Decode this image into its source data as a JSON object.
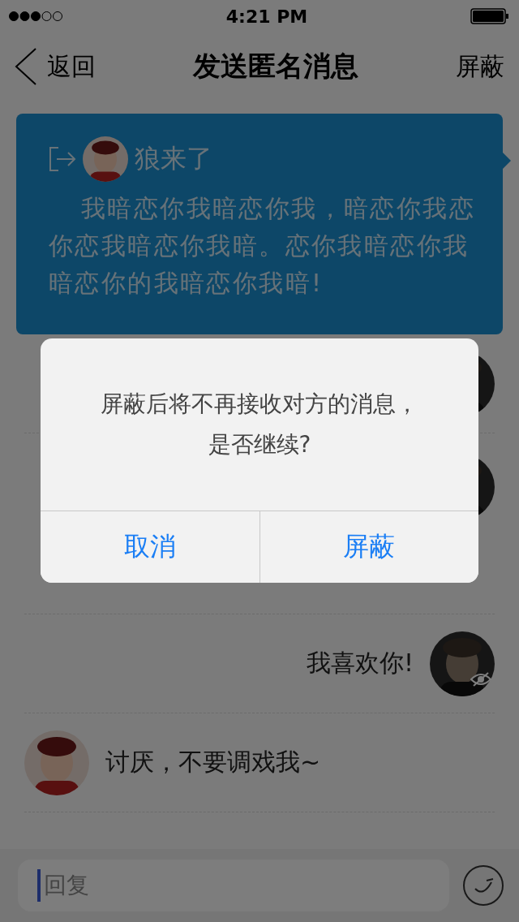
{
  "status_bar": {
    "time": "4:21 PM"
  },
  "nav": {
    "back": "返回",
    "title": "发送匿名消息",
    "action": "屏蔽"
  },
  "card": {
    "author": "狼来了",
    "text": "我暗恋你我暗恋你我，暗恋你我恋你恋我暗恋你我暗。恋你我暗恋你我暗恋你的我暗恋你我暗!"
  },
  "messages": [
    {
      "kind": "outgoing",
      "masked": false,
      "tall": false
    },
    {
      "kind": "outgoing",
      "masked": false,
      "tall": true
    },
    {
      "kind": "outgoing",
      "masked": true,
      "tall": false,
      "text": "我喜欢你!"
    },
    {
      "kind": "incoming",
      "tall": false,
      "text": "讨厌，不要调戏我~"
    }
  ],
  "reply": {
    "placeholder": "回复"
  },
  "dialog": {
    "message_lines": [
      "屏蔽后将不再接收对方的消息，",
      "是否继续?"
    ],
    "buttons": [
      "取消",
      "屏蔽"
    ]
  }
}
